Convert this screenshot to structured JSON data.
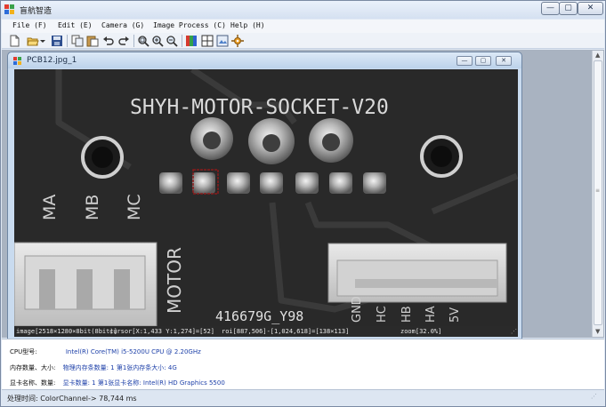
{
  "window": {
    "title": "盲航智造",
    "minimize_glyph": "—",
    "maximize_glyph": "▢",
    "close_glyph": "✕"
  },
  "menu": [
    {
      "label": "File (F)"
    },
    {
      "label": "Edit (E)"
    },
    {
      "label": "Camera (G)"
    },
    {
      "label": "Image Process (C)"
    },
    {
      "label": "Help (H)"
    }
  ],
  "toolbar": {
    "icons": [
      "new-file-icon",
      "open-folder-icon",
      "dropdown-arrow-icon",
      "save-icon",
      "copy-icon",
      "paste-icon",
      "undo-icon",
      "redo-icon",
      "zoom-fit-icon",
      "zoom-in-icon",
      "zoom-out-icon",
      "color-channel-icon",
      "grid-icon",
      "image-export-icon",
      "settings-icon"
    ]
  },
  "image_window": {
    "title": "PCB12.jpg_1",
    "board_text": "SHYH-MOTOR-SOCKET-V20",
    "labels": {
      "ma": "MA",
      "mb": "MB",
      "mc": "MC",
      "motor": "MOTOR",
      "serial": "416679G_Y98",
      "pins": [
        "GND",
        "HC",
        "HB",
        "HA",
        "5V"
      ]
    },
    "status": {
      "image": "image[2518×1280×8bit(8bit)]",
      "cursor": "cursor[X:1,433 Y:1,274]=[52]",
      "roi": "roi[887,506]-[1,024,618]=[138×113]",
      "zoom": "zoom[32.0%]"
    }
  },
  "info_panel": {
    "cpu_label": "CPU型号:",
    "cpu_value": "Intel(R) Core(TM) i5-5200U CPU @ 2.20GHz",
    "memory_label": "内存数量、大小:",
    "memory_value": "物理内存条数量: 1   第1张内存条大小: 4G",
    "gpu_label": "显卡名称、数量:",
    "gpu_value": "显卡数量: 1   第1张显卡名称: Intel(R) HD Graphics 5500"
  },
  "status_bar": {
    "text": "处理时间: ColorChannel-> 78,744 ms"
  },
  "colors": {
    "accent": "#1c3fa8",
    "board": "#262626",
    "roi_box": "#8b1a1a"
  }
}
